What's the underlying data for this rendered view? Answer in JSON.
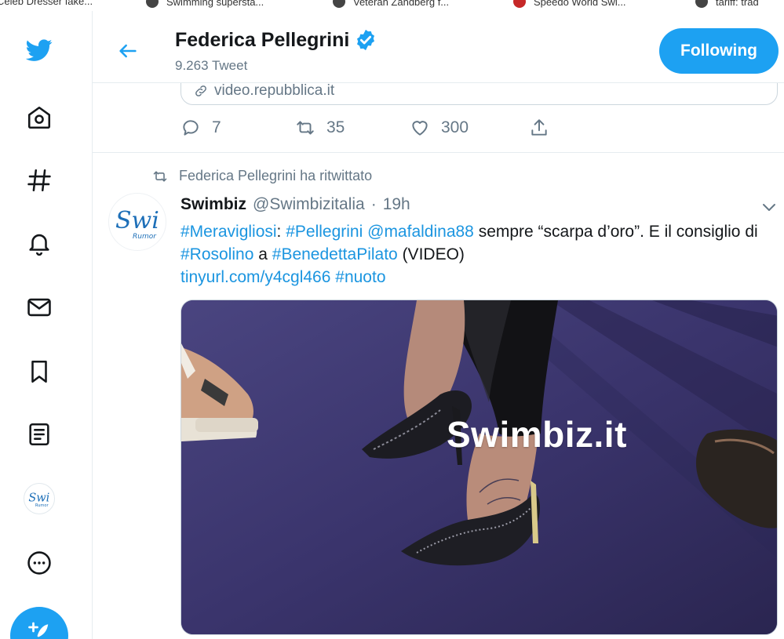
{
  "bookmarks": [
    {
      "label": "Celeb Dresser fake..."
    },
    {
      "label": "Swimming supersta..."
    },
    {
      "label": "Veteran Zandberg f..."
    },
    {
      "label": "Speedo World Swi..."
    },
    {
      "label": "tariff: trad"
    }
  ],
  "nav": {
    "items": [
      {
        "icon": "twitter-logo-icon"
      },
      {
        "icon": "home-icon"
      },
      {
        "icon": "explore-hashtag-icon"
      },
      {
        "icon": "notifications-bell-icon"
      },
      {
        "icon": "messages-envelope-icon"
      },
      {
        "icon": "bookmarks-icon"
      },
      {
        "icon": "lists-icon"
      },
      {
        "icon": "profile-avatar"
      },
      {
        "icon": "more-icon"
      }
    ],
    "compose_icon": "compose-tweet-icon"
  },
  "header": {
    "name": "Federica Pellegrini",
    "tweet_count": "9.263 Tweet",
    "follow_label": "Following"
  },
  "previous_tweet": {
    "card_link": "video.repubblica.it",
    "replies": "7",
    "retweets": "35",
    "likes": "300"
  },
  "tweet": {
    "retweeted_by": "Federica Pellegrini ha ritwittato",
    "author_name": "Swimbiz",
    "author_handle": "@Swimbizitalia",
    "separator": "·",
    "time": "19h",
    "avatar_text": "Swi",
    "avatar_subtext": "Rumor",
    "segments": {
      "s1": "#Meravigliosi",
      "s2": ": ",
      "s3": "#Pellegrini",
      "s4": " ",
      "s5": "@mafaldina88",
      "s6": "  sempre “scarpa d’oro”. E il consiglio di ",
      "s7": "#Rosolino",
      "s8": " a ",
      "s9": "#BenedettaPilato",
      "s10": " (VIDEO)",
      "s11": "tinyurl.com/y4cgl466",
      "s12": " ",
      "s13": "#nuoto"
    },
    "media_watermark": "Swimbiz.it"
  },
  "colors": {
    "accent": "#1da1f2",
    "link": "#1b95e0",
    "muted": "#657786",
    "border": "#e6ecf0"
  }
}
